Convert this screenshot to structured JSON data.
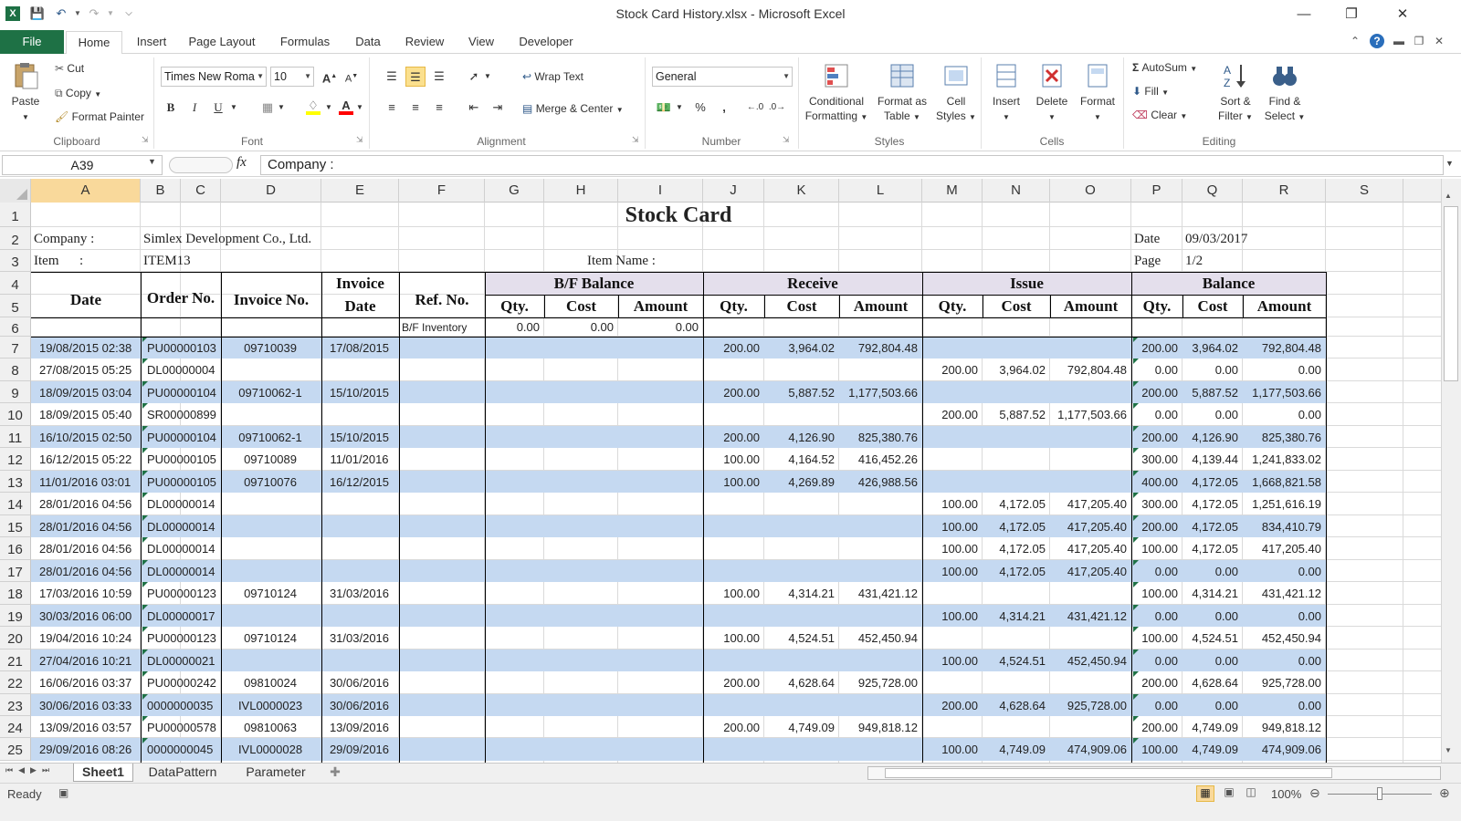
{
  "window": {
    "title": "Stock Card History.xlsx  -  Microsoft Excel",
    "app_icon": "X"
  },
  "tabs": {
    "file": "File",
    "items": [
      "Home",
      "Insert",
      "Page Layout",
      "Formulas",
      "Data",
      "Review",
      "View",
      "Developer"
    ]
  },
  "ribbon": {
    "clipboard": {
      "label": "Clipboard",
      "paste": "Paste",
      "cut": "Cut",
      "copy": "Copy",
      "format_painter": "Format Painter"
    },
    "font": {
      "label": "Font",
      "name": "Times New Roma",
      "size": "10",
      "bold": "B",
      "italic": "I",
      "underline": "U",
      "grow": "A",
      "shrink": "A",
      "fill_color": "#ffff00",
      "font_color": "#ff0000"
    },
    "alignment": {
      "label": "Alignment",
      "wrap": "Wrap Text",
      "merge": "Merge & Center"
    },
    "number": {
      "label": "Number",
      "format": "General",
      "percent": "%",
      "comma": ","
    },
    "styles": {
      "label": "Styles",
      "conditional_1": "Conditional",
      "conditional_2": "Formatting",
      "table_1": "Format as",
      "table_2": "Table",
      "cell_1": "Cell",
      "cell_2": "Styles"
    },
    "cells": {
      "label": "Cells",
      "insert": "Insert",
      "delete": "Delete",
      "format": "Format"
    },
    "editing": {
      "label": "Editing",
      "autosum": "AutoSum",
      "fill": "Fill",
      "clear": "Clear",
      "sort_1": "Sort &",
      "sort_2": "Filter",
      "find_1": "Find &",
      "find_2": "Select"
    }
  },
  "formula_bar": {
    "name_box": "A39",
    "fx": "fx",
    "content": "Company :"
  },
  "columns": [
    "A",
    "B",
    "C",
    "D",
    "E",
    "F",
    "G",
    "H",
    "I",
    "J",
    "K",
    "L",
    "M",
    "N",
    "O",
    "P",
    "Q",
    "R",
    "S"
  ],
  "row_numbers": [
    "1",
    "2",
    "3",
    "4",
    "5",
    "6",
    "7",
    "8",
    "9",
    "10",
    "11",
    "12",
    "13",
    "14",
    "15",
    "16",
    "17",
    "18",
    "19",
    "20",
    "21",
    "22",
    "23",
    "24",
    "25"
  ],
  "sheet": {
    "title": "Stock Card",
    "company_label": "Company :",
    "company_value": "Simlex Development Co., Ltd.",
    "item_label": "Item      :",
    "item_value": "ITEM13",
    "item_name_label": "Item Name :",
    "date_label": "Date",
    "date_value": "09/03/2017",
    "page_label": "Page",
    "page_value": "1/2",
    "headers": {
      "date": "Date",
      "order_no": "Order No.",
      "invoice_no": "Invoice No.",
      "invoice": "Invoice",
      "invoice_date": "Date",
      "ref_no": "Ref. No.",
      "bf_balance": "B/F Balance",
      "receive": "Receive",
      "issue": "Issue",
      "balance": "Balance",
      "qty": "Qty.",
      "cost": "Cost",
      "amount": "Amount"
    },
    "bf_row": {
      "label": "B/F Inventory",
      "qty": "0.00",
      "cost": "0.00",
      "amount": "0.00"
    },
    "rows": [
      {
        "date": "19/08/2015  02:38",
        "order": "PU00000103",
        "inv": "09710039",
        "invdate": "17/08/2015",
        "rq": "200.00",
        "rc": "3,964.02",
        "ra": "792,804.48",
        "iq": "",
        "ic": "",
        "ia": "",
        "bq": "200.00",
        "bc": "3,964.02",
        "ba": "792,804.48"
      },
      {
        "date": "27/08/2015  05:25",
        "order": "DL00000004",
        "inv": "",
        "invdate": "",
        "rq": "",
        "rc": "",
        "ra": "",
        "iq": "200.00",
        "ic": "3,964.02",
        "ia": "792,804.48",
        "bq": "0.00",
        "bc": "0.00",
        "ba": "0.00"
      },
      {
        "date": "18/09/2015  03:04",
        "order": "PU00000104",
        "inv": "09710062-1",
        "invdate": "15/10/2015",
        "rq": "200.00",
        "rc": "5,887.52",
        "ra": "1,177,503.66",
        "iq": "",
        "ic": "",
        "ia": "",
        "bq": "200.00",
        "bc": "5,887.52",
        "ba": "1,177,503.66"
      },
      {
        "date": "18/09/2015  05:40",
        "order": "SR00000899",
        "inv": "",
        "invdate": "",
        "rq": "",
        "rc": "",
        "ra": "",
        "iq": "200.00",
        "ic": "5,887.52",
        "ia": "1,177,503.66",
        "bq": "0.00",
        "bc": "0.00",
        "ba": "0.00"
      },
      {
        "date": "16/10/2015  02:50",
        "order": "PU00000104",
        "inv": "09710062-1",
        "invdate": "15/10/2015",
        "rq": "200.00",
        "rc": "4,126.90",
        "ra": "825,380.76",
        "iq": "",
        "ic": "",
        "ia": "",
        "bq": "200.00",
        "bc": "4,126.90",
        "ba": "825,380.76"
      },
      {
        "date": "16/12/2015  05:22",
        "order": "PU00000105",
        "inv": "09710089",
        "invdate": "11/01/2016",
        "rq": "100.00",
        "rc": "4,164.52",
        "ra": "416,452.26",
        "iq": "",
        "ic": "",
        "ia": "",
        "bq": "300.00",
        "bc": "4,139.44",
        "ba": "1,241,833.02"
      },
      {
        "date": "11/01/2016  03:01",
        "order": "PU00000105",
        "inv": "09710076",
        "invdate": "16/12/2015",
        "rq": "100.00",
        "rc": "4,269.89",
        "ra": "426,988.56",
        "iq": "",
        "ic": "",
        "ia": "",
        "bq": "400.00",
        "bc": "4,172.05",
        "ba": "1,668,821.58"
      },
      {
        "date": "28/01/2016  04:56",
        "order": "DL00000014",
        "inv": "",
        "invdate": "",
        "rq": "",
        "rc": "",
        "ra": "",
        "iq": "100.00",
        "ic": "4,172.05",
        "ia": "417,205.40",
        "bq": "300.00",
        "bc": "4,172.05",
        "ba": "1,251,616.19"
      },
      {
        "date": "28/01/2016  04:56",
        "order": "DL00000014",
        "inv": "",
        "invdate": "",
        "rq": "",
        "rc": "",
        "ra": "",
        "iq": "100.00",
        "ic": "4,172.05",
        "ia": "417,205.40",
        "bq": "200.00",
        "bc": "4,172.05",
        "ba": "834,410.79"
      },
      {
        "date": "28/01/2016  04:56",
        "order": "DL00000014",
        "inv": "",
        "invdate": "",
        "rq": "",
        "rc": "",
        "ra": "",
        "iq": "100.00",
        "ic": "4,172.05",
        "ia": "417,205.40",
        "bq": "100.00",
        "bc": "4,172.05",
        "ba": "417,205.40"
      },
      {
        "date": "28/01/2016  04:56",
        "order": "DL00000014",
        "inv": "",
        "invdate": "",
        "rq": "",
        "rc": "",
        "ra": "",
        "iq": "100.00",
        "ic": "4,172.05",
        "ia": "417,205.40",
        "bq": "0.00",
        "bc": "0.00",
        "ba": "0.00"
      },
      {
        "date": "17/03/2016  10:59",
        "order": "PU00000123",
        "inv": "09710124",
        "invdate": "31/03/2016",
        "rq": "100.00",
        "rc": "4,314.21",
        "ra": "431,421.12",
        "iq": "",
        "ic": "",
        "ia": "",
        "bq": "100.00",
        "bc": "4,314.21",
        "ba": "431,421.12"
      },
      {
        "date": "30/03/2016  06:00",
        "order": "DL00000017",
        "inv": "",
        "invdate": "",
        "rq": "",
        "rc": "",
        "ra": "",
        "iq": "100.00",
        "ic": "4,314.21",
        "ia": "431,421.12",
        "bq": "0.00",
        "bc": "0.00",
        "ba": "0.00"
      },
      {
        "date": "19/04/2016  10:24",
        "order": "PU00000123",
        "inv": "09710124",
        "invdate": "31/03/2016",
        "rq": "100.00",
        "rc": "4,524.51",
        "ra": "452,450.94",
        "iq": "",
        "ic": "",
        "ia": "",
        "bq": "100.00",
        "bc": "4,524.51",
        "ba": "452,450.94"
      },
      {
        "date": "27/04/2016  10:21",
        "order": "DL00000021",
        "inv": "",
        "invdate": "",
        "rq": "",
        "rc": "",
        "ra": "",
        "iq": "100.00",
        "ic": "4,524.51",
        "ia": "452,450.94",
        "bq": "0.00",
        "bc": "0.00",
        "ba": "0.00"
      },
      {
        "date": "16/06/2016  03:37",
        "order": "PU00000242",
        "inv": "09810024",
        "invdate": "30/06/2016",
        "rq": "200.00",
        "rc": "4,628.64",
        "ra": "925,728.00",
        "iq": "",
        "ic": "",
        "ia": "",
        "bq": "200.00",
        "bc": "4,628.64",
        "ba": "925,728.00"
      },
      {
        "date": "30/06/2016  03:33",
        "order": "0000000035",
        "inv": "IVL0000023",
        "invdate": "30/06/2016",
        "rq": "",
        "rc": "",
        "ra": "",
        "iq": "200.00",
        "ic": "4,628.64",
        "ia": "925,728.00",
        "bq": "0.00",
        "bc": "0.00",
        "ba": "0.00"
      },
      {
        "date": "13/09/2016  03:57",
        "order": "PU00000578",
        "inv": "09810063",
        "invdate": "13/09/2016",
        "rq": "200.00",
        "rc": "4,749.09",
        "ra": "949,818.12",
        "iq": "",
        "ic": "",
        "ia": "",
        "bq": "200.00",
        "bc": "4,749.09",
        "ba": "949,818.12"
      },
      {
        "date": "29/09/2016  08:26",
        "order": "0000000045",
        "inv": "IVL0000028",
        "invdate": "29/09/2016",
        "rq": "",
        "rc": "",
        "ra": "",
        "iq": "100.00",
        "ic": "4,749.09",
        "ia": "474,909.06",
        "bq": "100.00",
        "bc": "4,749.09",
        "ba": "474,909.06"
      }
    ]
  },
  "sheet_tabs": [
    "Sheet1",
    "DataPattern",
    "Parameter"
  ],
  "status": {
    "ready": "Ready",
    "zoom": "100%"
  },
  "colors": {
    "band": "#c5d9f1",
    "header_fill": "#e4dfec",
    "excel_green": "#1e7145",
    "selected_header": "#f9d99b"
  }
}
